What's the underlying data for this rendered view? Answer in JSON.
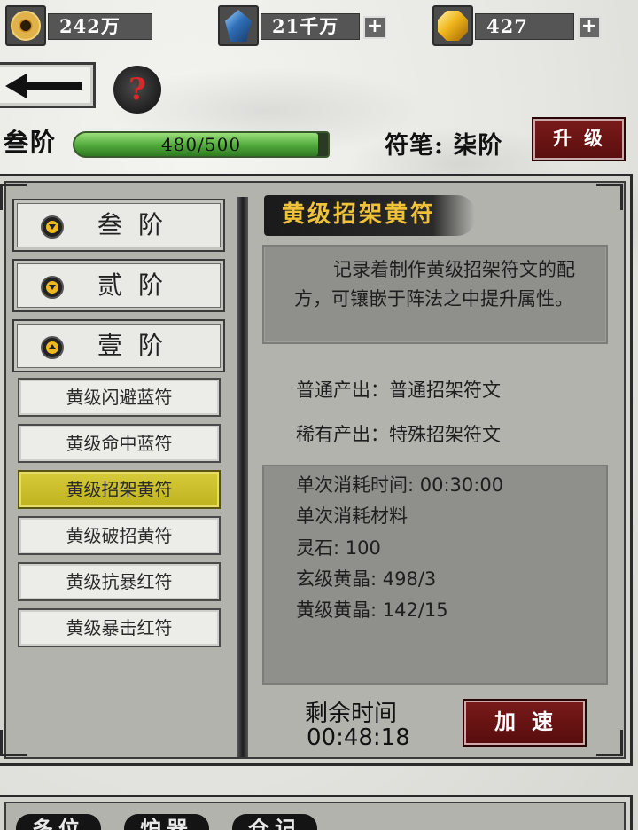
{
  "currencies": {
    "yinyang_amount": "242万",
    "crystal_amount": "21千万",
    "gold_amount": "427"
  },
  "help_symbol": "?",
  "level": {
    "tier_label": "叁阶",
    "xp_current": 480,
    "xp_max": 500,
    "xp_text": "480/500",
    "pen_label": "符笔: 柒阶",
    "upgrade_label": "升级"
  },
  "tiers": [
    {
      "label": "叁阶",
      "expanded": false
    },
    {
      "label": "贰阶",
      "expanded": false
    },
    {
      "label": "壹阶",
      "expanded": true
    }
  ],
  "recipes": [
    {
      "label": "黄级闪避蓝符",
      "selected": false
    },
    {
      "label": "黄级命中蓝符",
      "selected": false
    },
    {
      "label": "黄级招架黄符",
      "selected": true
    },
    {
      "label": "黄级破招黄符",
      "selected": false
    },
    {
      "label": "黄级抗暴红符",
      "selected": false
    },
    {
      "label": "黄级暴击红符",
      "selected": false
    }
  ],
  "detail": {
    "title": "黄级招架黄符",
    "description": "记录着制作黄级招架符文的配方，可镶嵌于阵法之中提升属性。",
    "normal_output": "普通产出：普通招架符文",
    "rare_output": "稀有产出：特殊招架符文",
    "costs": [
      "单次消耗时间: 00:30:00",
      "单次消耗材料",
      "灵石: 100",
      "玄级黄晶: 498/3",
      "黄级黄晶: 142/15"
    ],
    "remaining_label": "剩余时间",
    "remaining_time": "00:48:18",
    "speedup_label": "加速"
  },
  "bottom_tabs": [
    "多位",
    "炉器",
    "仓记"
  ]
}
